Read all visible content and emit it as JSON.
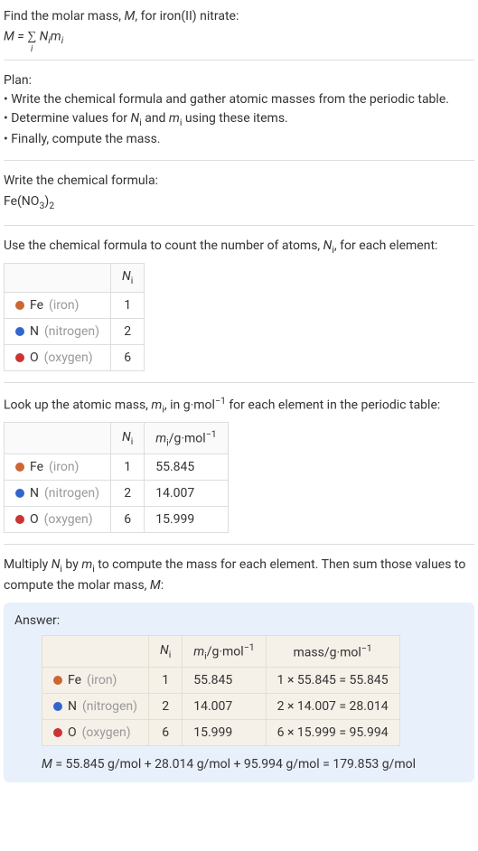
{
  "intro": {
    "line1_prefix": "Find the molar mass, ",
    "line1_var": "M",
    "line1_suffix": ", for iron(II) nitrate:",
    "formula_lhs": "M",
    "formula_eq": " = ",
    "formula_sigma": "∑",
    "formula_sub": "i",
    "formula_rhs1": " N",
    "formula_rhs1_sub": "i",
    "formula_rhs2": "m",
    "formula_rhs2_sub": "i"
  },
  "plan": {
    "heading": "Plan:",
    "bullet1": "• Write the chemical formula and gather atomic masses from the periodic table.",
    "bullet2_prefix": "• Determine values for ",
    "bullet2_n": "N",
    "bullet2_n_sub": "i",
    "bullet2_and": " and ",
    "bullet2_m": "m",
    "bullet2_m_sub": "i",
    "bullet2_suffix": " using these items.",
    "bullet3": "• Finally, compute the mass."
  },
  "write_formula": {
    "heading": "Write the chemical formula:",
    "fe": "Fe(NO",
    "sub1": "3",
    "mid": ")",
    "sub2": "2"
  },
  "count_atoms": {
    "heading_prefix": "Use the chemical formula to count the number of atoms, ",
    "heading_n": "N",
    "heading_n_sub": "i",
    "heading_suffix": ", for each element:",
    "header_n": "N",
    "header_n_sub": "i",
    "rows": [
      {
        "dot": "dot-fe",
        "sym": "Fe",
        "name": "(iron)",
        "n": "1"
      },
      {
        "dot": "dot-n",
        "sym": "N",
        "name": "(nitrogen)",
        "n": "2"
      },
      {
        "dot": "dot-o",
        "sym": "O",
        "name": "(oxygen)",
        "n": "6"
      }
    ]
  },
  "atomic_mass": {
    "heading_prefix": "Look up the atomic mass, ",
    "heading_m": "m",
    "heading_m_sub": "i",
    "heading_mid": ", in g·mol",
    "heading_exp": "−1",
    "heading_suffix": " for each element in the periodic table:",
    "header_n": "N",
    "header_n_sub": "i",
    "header_m": "m",
    "header_m_sub": "i",
    "header_m_unit": "/g·mol",
    "header_m_exp": "−1",
    "rows": [
      {
        "dot": "dot-fe",
        "sym": "Fe",
        "name": "(iron)",
        "n": "1",
        "m": "55.845"
      },
      {
        "dot": "dot-n",
        "sym": "N",
        "name": "(nitrogen)",
        "n": "2",
        "m": "14.007"
      },
      {
        "dot": "dot-o",
        "sym": "O",
        "name": "(oxygen)",
        "n": "6",
        "m": "15.999"
      }
    ]
  },
  "multiply": {
    "line_prefix": "Multiply ",
    "n_var": "N",
    "n_sub": "i",
    "by": " by ",
    "m_var": "m",
    "m_sub": "i",
    "mid": " to compute the mass for each element. Then sum those values to compute the molar mass, ",
    "M": "M",
    "colon": ":"
  },
  "answer": {
    "label": "Answer:",
    "header_n": "N",
    "header_n_sub": "i",
    "header_m": "m",
    "header_m_sub": "i",
    "header_m_unit": "/g·mol",
    "header_m_exp": "−1",
    "header_mass": "mass/g·mol",
    "header_mass_exp": "−1",
    "rows": [
      {
        "dot": "dot-fe",
        "sym": "Fe",
        "name": "(iron)",
        "n": "1",
        "m": "55.845",
        "calc": "1 × 55.845 = 55.845"
      },
      {
        "dot": "dot-n",
        "sym": "N",
        "name": "(nitrogen)",
        "n": "2",
        "m": "14.007",
        "calc": "2 × 14.007 = 28.014"
      },
      {
        "dot": "dot-o",
        "sym": "O",
        "name": "(oxygen)",
        "n": "6",
        "m": "15.999",
        "calc": "6 × 15.999 = 95.994"
      }
    ],
    "final_var": "M",
    "final_eq": " = 55.845 g/mol + 28.014 g/mol + 95.994 g/mol = 179.853 g/mol"
  }
}
